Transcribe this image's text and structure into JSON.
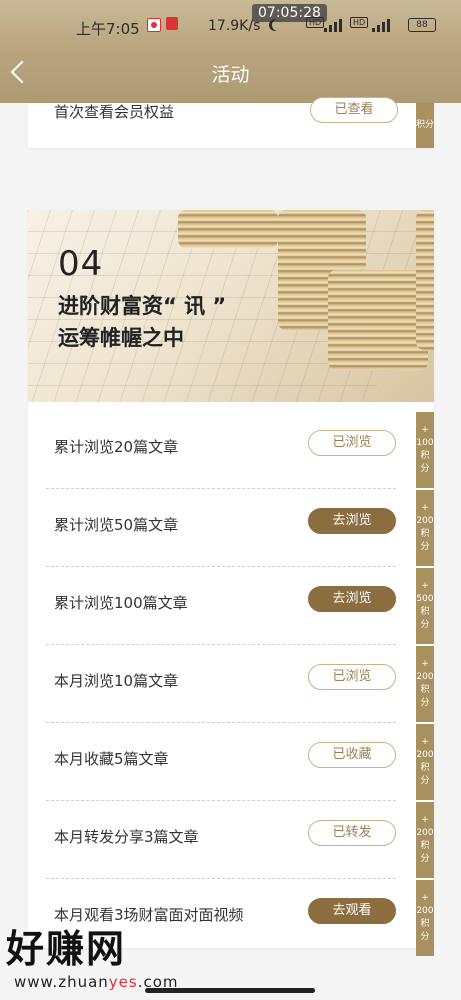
{
  "status_bar": {
    "time": "上午7:05",
    "recording_time": "07:05:28",
    "net_speed": "17.9K/s",
    "battery": "88",
    "hd_label": "HD",
    "net_4g": "4G"
  },
  "nav": {
    "title": "活动"
  },
  "top_task": {
    "label": "首次查看会员权益",
    "button": "已查看",
    "points_label": "积分"
  },
  "banner": {
    "number": "04",
    "line1": "进阶财富资“ 讯 ”",
    "line2": "运筹帷幄之中"
  },
  "tasks": [
    {
      "label": "累计浏览20篇文章",
      "button": "已浏览",
      "state": "done",
      "plus": "+",
      "points": "100",
      "unit": "积分"
    },
    {
      "label": "累计浏览50篇文章",
      "button": "去浏览",
      "state": "go",
      "plus": "+",
      "points": "200",
      "unit": "积分"
    },
    {
      "label": "累计浏览100篇文章",
      "button": "去浏览",
      "state": "go",
      "plus": "+",
      "points": "500",
      "unit": "积分"
    },
    {
      "label": "本月浏览10篇文章",
      "button": "已浏览",
      "state": "done",
      "plus": "+",
      "points": "200",
      "unit": "积分"
    },
    {
      "label": "本月收藏5篇文章",
      "button": "已收藏",
      "state": "done",
      "plus": "+",
      "points": "200",
      "unit": "积分"
    },
    {
      "label": "本月转发分享3篇文章",
      "button": "已转发",
      "state": "done",
      "plus": "+",
      "points": "200",
      "unit": "积分"
    },
    {
      "label": "本月观看3场财富面对面视频",
      "button": "去观看",
      "state": "go",
      "plus": "+",
      "points": "200",
      "unit": "积分"
    }
  ],
  "watermark": {
    "big": "好赚网",
    "small_prefix": "www.zhuan",
    "small_accent": "yes",
    "small_suffix": ".com"
  },
  "colors": {
    "gold_header": "#b9a47d",
    "button_go": "#8b6d3f",
    "points_strip": "#a8915f"
  },
  "icons": [
    "back-arrow-icon",
    "alarm-icon",
    "moon-icon",
    "signal-icon",
    "battery-icon"
  ]
}
